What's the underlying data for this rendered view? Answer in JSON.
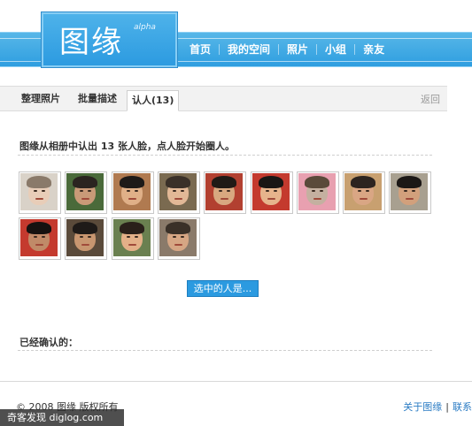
{
  "header": {
    "logo_text": "图缘",
    "logo_tag": "alpha",
    "nav": [
      "首页",
      "我的空间",
      "照片",
      "小组",
      "亲友"
    ]
  },
  "tabs": {
    "items": [
      "整理照片",
      "批量描述",
      "认人(13)"
    ],
    "active_index": 2,
    "back_label": "返回"
  },
  "content": {
    "intro_text": "图缘从相册中认出 13 张人脸，点人脸开始圈人。",
    "faces_count": 13,
    "select_button_label": "选中的人是...",
    "confirmed_label": "已经确认的："
  },
  "footer": {
    "copyright": "© 2008 图缘 版权所有",
    "links": [
      "关于图缘",
      "联系"
    ],
    "link_separator": "|"
  },
  "watermark": "奇客发现 diglog.com",
  "colors": {
    "accent": "#2b9ae0",
    "link": "#2b7cc4"
  }
}
